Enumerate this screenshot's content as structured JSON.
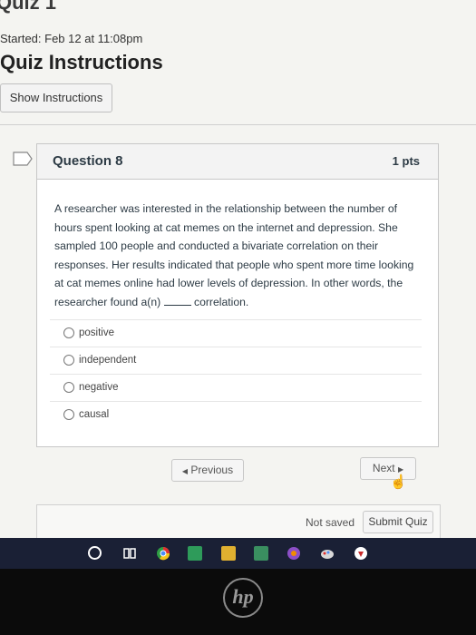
{
  "header": {
    "quiz_title": "Quiz 1",
    "started": "Started: Feb 12 at 11:08pm",
    "instructions_title": "Quiz Instructions",
    "show_instructions_label": "Show Instructions"
  },
  "question": {
    "name": "Question 8",
    "points": "1 pts",
    "text_before_blank": "A researcher was interested in the relationship between the number of hours spent looking at cat memes on the internet and depression. She sampled 100 people and conducted a bivariate correlation on their responses. Her results indicated that people who spent more time looking at cat memes online had lower levels of depression. In other words, the researcher found a(n)",
    "text_after_blank": "correlation.",
    "answers": [
      "positive",
      "independent",
      "negative",
      "causal"
    ]
  },
  "nav": {
    "previous_label": "Previous",
    "next_label": "Next"
  },
  "footer": {
    "status": "Not saved",
    "submit_label": "Submit Quiz"
  },
  "device": {
    "brand": "hp"
  },
  "colors": {
    "text": "#2d3b45",
    "taskbar": "#1a2035",
    "bezel": "#0b0b0b"
  }
}
